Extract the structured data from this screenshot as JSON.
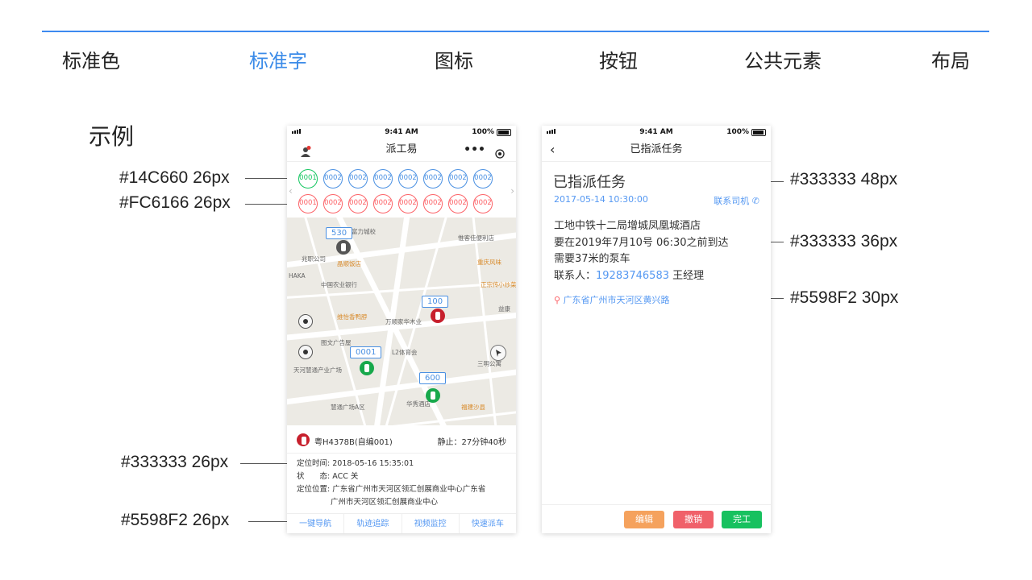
{
  "nav": {
    "items": [
      "标准色",
      "标准字",
      "图标",
      "按钮",
      "公共元素",
      "布局"
    ],
    "active_index": 1
  },
  "section_title": "示例",
  "annotations": {
    "green_circle": "#14C660 26px",
    "red_circle": "#FC6166 26px",
    "info_text": "#333333 26px",
    "tab_text": "#5598F2 26px",
    "task_title": "#333333 48px",
    "task_body": "#333333 36px",
    "task_addr": "#5598F2 30px"
  },
  "phone1": {
    "status": {
      "time": "9:41 AM",
      "battery": "100%"
    },
    "title": "派工易",
    "circles_top": [
      "0001",
      "0002",
      "0002",
      "0002",
      "0002",
      "0002",
      "0002",
      "0002"
    ],
    "circles_bottom": [
      "0001",
      "0002",
      "0002",
      "0002",
      "0002",
      "0002",
      "0002",
      "0002"
    ],
    "map": {
      "labels": [
        "富力城校",
        "惟客佳便利店",
        "兆职公司",
        "晶顺饭店",
        "重庆风味",
        "中国农业银行",
        "HAKA",
        "正宗传",
        "小炒菜",
        "益康",
        "维怡香鸭脖",
        "万顺家华木业",
        "图文广告屋",
        "天河慧通产业广场",
        "L2体育会",
        "三明公寓",
        "华秀酒店",
        "慧通广场A区",
        "福建沙县"
      ],
      "car_tags": [
        "530",
        "100",
        "0001",
        "600"
      ]
    },
    "vehicle": {
      "plate": "粤H4378B(自编001)",
      "status": "静止：27分钟40秒"
    },
    "info": {
      "time_label": "定位时间:",
      "time_value": "2018-05-16 15:35:01",
      "state_label": "状　　态:",
      "state_value": "ACC 关",
      "location_label": "定位位置:",
      "location_line1": "广东省广州市天河区领汇创展商业中心广东省",
      "location_line2": "广州市天河区领汇创展商业中心"
    },
    "tabs": [
      "一键导航",
      "轨迹追踪",
      "视频监控",
      "快速派车"
    ]
  },
  "phone2": {
    "status": {
      "time": "9:41 AM",
      "battery": "100%"
    },
    "title": "已指派任务",
    "task_title": "已指派任务",
    "date": "2017-05-14 10:30:00",
    "contact_driver": "联系司机",
    "body": {
      "line1": "工地中铁十二局增城凤凰城酒店",
      "line2": "要在2019年7月10号  06:30之前到达",
      "line3": "需要37米的泵车",
      "contact_label": "联系人：",
      "contact_phone": "19283746583",
      "contact_name": "王经理"
    },
    "address": "广东省广州市天河区黄兴路",
    "buttons": {
      "edit": "编辑",
      "cancel": "撤销",
      "finish": "完工"
    }
  },
  "colors": {
    "accent": "#3b8be8",
    "green": "#14C660",
    "red": "#FC6166",
    "blue": "#5598F2",
    "text": "#333333",
    "orange": "#F5A25D",
    "btn_red": "#F0616A",
    "btn_green": "#17C15F"
  }
}
